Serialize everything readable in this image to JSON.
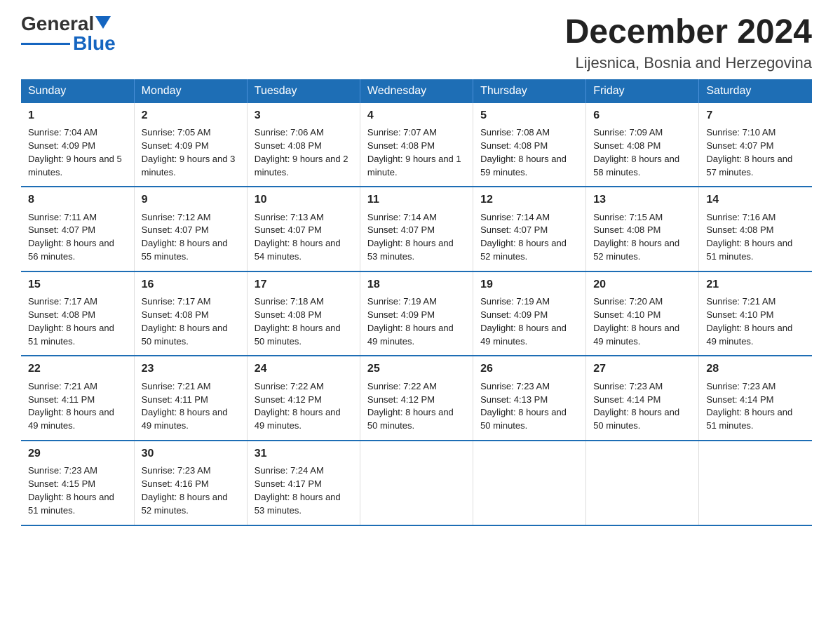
{
  "logo": {
    "text1": "General",
    "text2": "Blue"
  },
  "header": {
    "month": "December 2024",
    "location": "Lijesnica, Bosnia and Herzegovina"
  },
  "weekdays": [
    "Sunday",
    "Monday",
    "Tuesday",
    "Wednesday",
    "Thursday",
    "Friday",
    "Saturday"
  ],
  "weeks": [
    [
      {
        "day": "1",
        "sunrise": "7:04 AM",
        "sunset": "4:09 PM",
        "daylight": "9 hours and 5 minutes."
      },
      {
        "day": "2",
        "sunrise": "7:05 AM",
        "sunset": "4:09 PM",
        "daylight": "9 hours and 3 minutes."
      },
      {
        "day": "3",
        "sunrise": "7:06 AM",
        "sunset": "4:08 PM",
        "daylight": "9 hours and 2 minutes."
      },
      {
        "day": "4",
        "sunrise": "7:07 AM",
        "sunset": "4:08 PM",
        "daylight": "9 hours and 1 minute."
      },
      {
        "day": "5",
        "sunrise": "7:08 AM",
        "sunset": "4:08 PM",
        "daylight": "8 hours and 59 minutes."
      },
      {
        "day": "6",
        "sunrise": "7:09 AM",
        "sunset": "4:08 PM",
        "daylight": "8 hours and 58 minutes."
      },
      {
        "day": "7",
        "sunrise": "7:10 AM",
        "sunset": "4:07 PM",
        "daylight": "8 hours and 57 minutes."
      }
    ],
    [
      {
        "day": "8",
        "sunrise": "7:11 AM",
        "sunset": "4:07 PM",
        "daylight": "8 hours and 56 minutes."
      },
      {
        "day": "9",
        "sunrise": "7:12 AM",
        "sunset": "4:07 PM",
        "daylight": "8 hours and 55 minutes."
      },
      {
        "day": "10",
        "sunrise": "7:13 AM",
        "sunset": "4:07 PM",
        "daylight": "8 hours and 54 minutes."
      },
      {
        "day": "11",
        "sunrise": "7:14 AM",
        "sunset": "4:07 PM",
        "daylight": "8 hours and 53 minutes."
      },
      {
        "day": "12",
        "sunrise": "7:14 AM",
        "sunset": "4:07 PM",
        "daylight": "8 hours and 52 minutes."
      },
      {
        "day": "13",
        "sunrise": "7:15 AM",
        "sunset": "4:08 PM",
        "daylight": "8 hours and 52 minutes."
      },
      {
        "day": "14",
        "sunrise": "7:16 AM",
        "sunset": "4:08 PM",
        "daylight": "8 hours and 51 minutes."
      }
    ],
    [
      {
        "day": "15",
        "sunrise": "7:17 AM",
        "sunset": "4:08 PM",
        "daylight": "8 hours and 51 minutes."
      },
      {
        "day": "16",
        "sunrise": "7:17 AM",
        "sunset": "4:08 PM",
        "daylight": "8 hours and 50 minutes."
      },
      {
        "day": "17",
        "sunrise": "7:18 AM",
        "sunset": "4:08 PM",
        "daylight": "8 hours and 50 minutes."
      },
      {
        "day": "18",
        "sunrise": "7:19 AM",
        "sunset": "4:09 PM",
        "daylight": "8 hours and 49 minutes."
      },
      {
        "day": "19",
        "sunrise": "7:19 AM",
        "sunset": "4:09 PM",
        "daylight": "8 hours and 49 minutes."
      },
      {
        "day": "20",
        "sunrise": "7:20 AM",
        "sunset": "4:10 PM",
        "daylight": "8 hours and 49 minutes."
      },
      {
        "day": "21",
        "sunrise": "7:21 AM",
        "sunset": "4:10 PM",
        "daylight": "8 hours and 49 minutes."
      }
    ],
    [
      {
        "day": "22",
        "sunrise": "7:21 AM",
        "sunset": "4:11 PM",
        "daylight": "8 hours and 49 minutes."
      },
      {
        "day": "23",
        "sunrise": "7:21 AM",
        "sunset": "4:11 PM",
        "daylight": "8 hours and 49 minutes."
      },
      {
        "day": "24",
        "sunrise": "7:22 AM",
        "sunset": "4:12 PM",
        "daylight": "8 hours and 49 minutes."
      },
      {
        "day": "25",
        "sunrise": "7:22 AM",
        "sunset": "4:12 PM",
        "daylight": "8 hours and 50 minutes."
      },
      {
        "day": "26",
        "sunrise": "7:23 AM",
        "sunset": "4:13 PM",
        "daylight": "8 hours and 50 minutes."
      },
      {
        "day": "27",
        "sunrise": "7:23 AM",
        "sunset": "4:14 PM",
        "daylight": "8 hours and 50 minutes."
      },
      {
        "day": "28",
        "sunrise": "7:23 AM",
        "sunset": "4:14 PM",
        "daylight": "8 hours and 51 minutes."
      }
    ],
    [
      {
        "day": "29",
        "sunrise": "7:23 AM",
        "sunset": "4:15 PM",
        "daylight": "8 hours and 51 minutes."
      },
      {
        "day": "30",
        "sunrise": "7:23 AM",
        "sunset": "4:16 PM",
        "daylight": "8 hours and 52 minutes."
      },
      {
        "day": "31",
        "sunrise": "7:24 AM",
        "sunset": "4:17 PM",
        "daylight": "8 hours and 53 minutes."
      },
      null,
      null,
      null,
      null
    ]
  ],
  "labels": {
    "sunrise": "Sunrise:",
    "sunset": "Sunset:",
    "daylight": "Daylight:"
  }
}
